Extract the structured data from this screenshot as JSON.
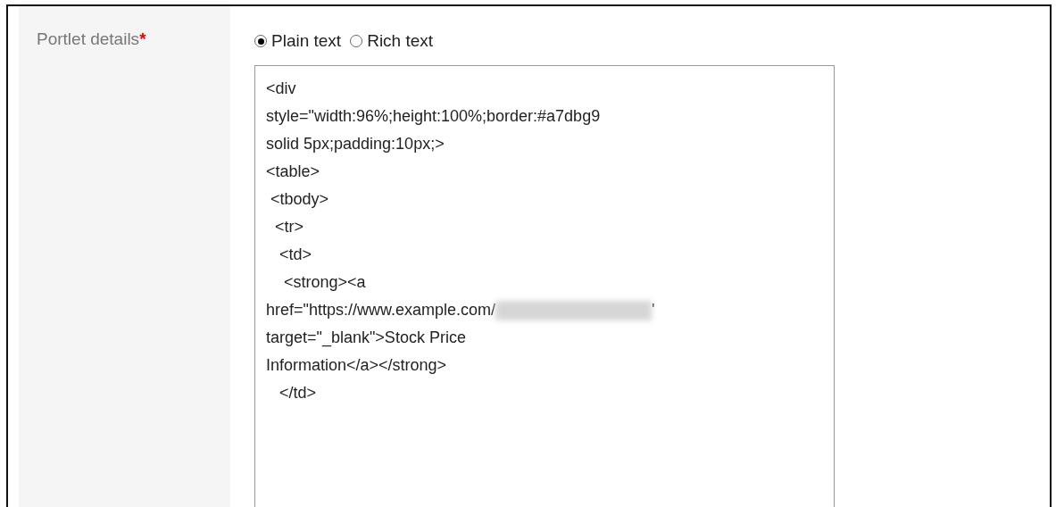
{
  "field": {
    "label": "Portlet details",
    "required_mark": "*"
  },
  "format_options": [
    {
      "label": "Plain text",
      "selected": true
    },
    {
      "label": "Rich text",
      "selected": false
    }
  ],
  "editor_lines": [
    {
      "text": "<div"
    },
    {
      "text": "style=\"width:96%;height:100%;border:#a7dbg9"
    },
    {
      "text": "solid 5px;padding:10px;>"
    },
    {
      "text": "<table>"
    },
    {
      "text": " <tbody>"
    },
    {
      "text": "  <tr>"
    },
    {
      "text": "   <td>"
    },
    {
      "text": "    <strong><a"
    },
    {
      "text": "href=\"https://www.example.com/",
      "redacted": true,
      "after": "'"
    },
    {
      "text": "target=\"_blank\">Stock Price"
    },
    {
      "text": "Information</a></strong>"
    },
    {
      "text": "   </td>"
    }
  ]
}
